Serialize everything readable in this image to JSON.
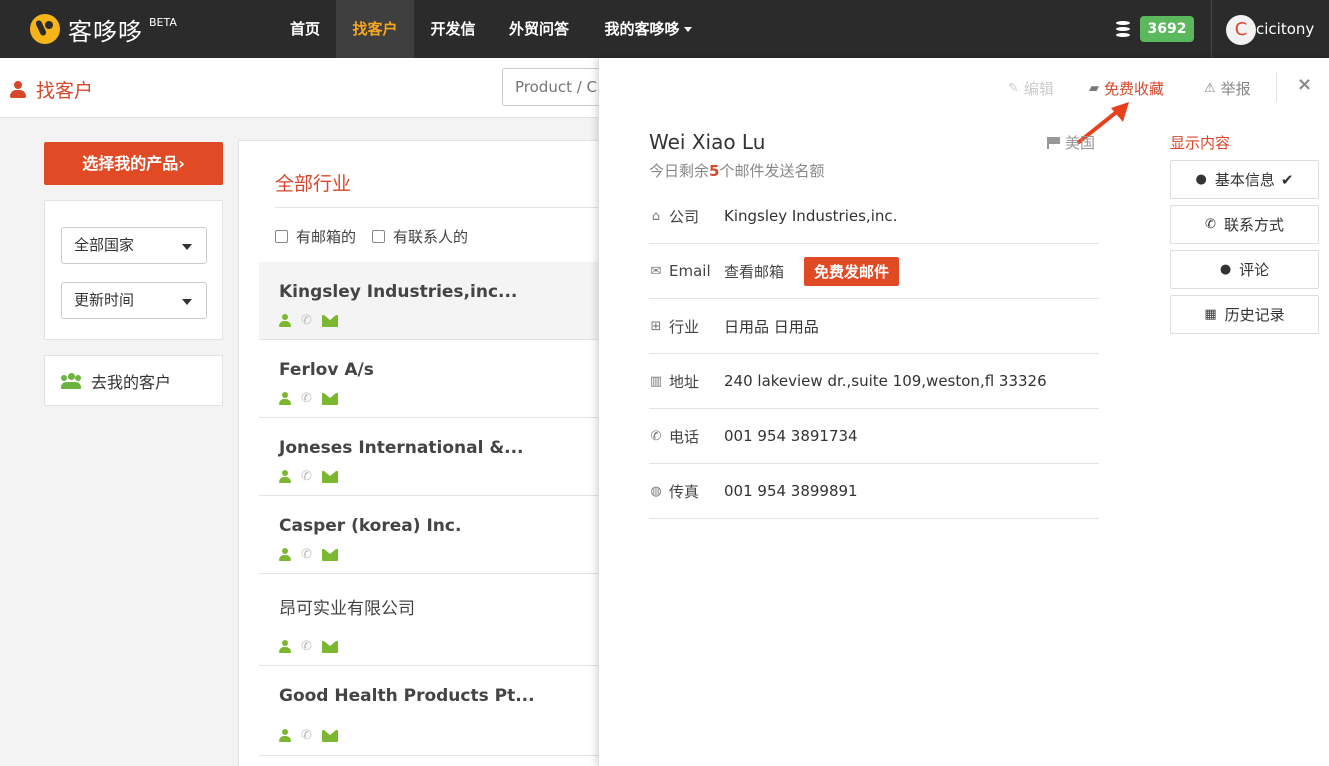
{
  "nav": {
    "logo_text": "客哆哆",
    "beta": "BETA",
    "items": [
      {
        "label": "首页"
      },
      {
        "label": "找客户"
      },
      {
        "label": "开发信"
      },
      {
        "label": "外贸问答"
      },
      {
        "label": "我的客哆哆"
      }
    ],
    "credits": "3692",
    "avatar_letter": "C",
    "username": "cicitony"
  },
  "header": {
    "title": "找客户",
    "search_placeholder": "Product / C"
  },
  "sidebar": {
    "select_product": "选择我的产品",
    "select_product_chevron": "›",
    "country_select": "全部国家",
    "sort_select": "更新时间",
    "my_customers": "去我的客户"
  },
  "list": {
    "title": "全部行业",
    "filter_has_email": "有邮箱的",
    "filter_has_contact": "有联系人的",
    "customers": [
      {
        "name": "Kingsley Industries,inc..."
      },
      {
        "name": "Ferlov A/s"
      },
      {
        "name": "Joneses International &..."
      },
      {
        "name": "Casper (korea) Inc."
      },
      {
        "name": "昂可实业有限公司"
      },
      {
        "name": "Good Health Products Pt..."
      }
    ]
  },
  "detail": {
    "toolbar": {
      "edit": "编辑",
      "favorite": "免费收藏",
      "report": "举报",
      "close": "×"
    },
    "contact_name": "Wei Xiao Lu",
    "country": "美国",
    "quota_prefix": "今日剩余",
    "quota_count": "5",
    "quota_suffix": "个邮件发送名额",
    "rows": {
      "company_label": "公司",
      "company_value": "Kingsley Industries,inc.",
      "email_label": "Email",
      "view_email": "查看邮箱",
      "send_free": "免费发邮件",
      "industry_label": "行业",
      "industry_value": "日用品 日用品",
      "address_label": "地址",
      "address_value": "240 lakeview dr.,suite 109,weston,fl 33326",
      "phone_label": "电话",
      "phone_value": "001 954 3891734",
      "fax_label": "传真",
      "fax_value": "001 954 3899891"
    },
    "display_panel": {
      "title": "显示内容",
      "basic_info": "基本信息",
      "check": "✔",
      "contact_methods": "联系方式",
      "comments": "评论",
      "history": "历史记录"
    }
  },
  "colors": {
    "brand_red": "#e04a25",
    "nav_bg": "#2b2b2b",
    "nav_active": "#f5a623",
    "green": "#7cb82f",
    "credit_green": "#5cb85c"
  }
}
